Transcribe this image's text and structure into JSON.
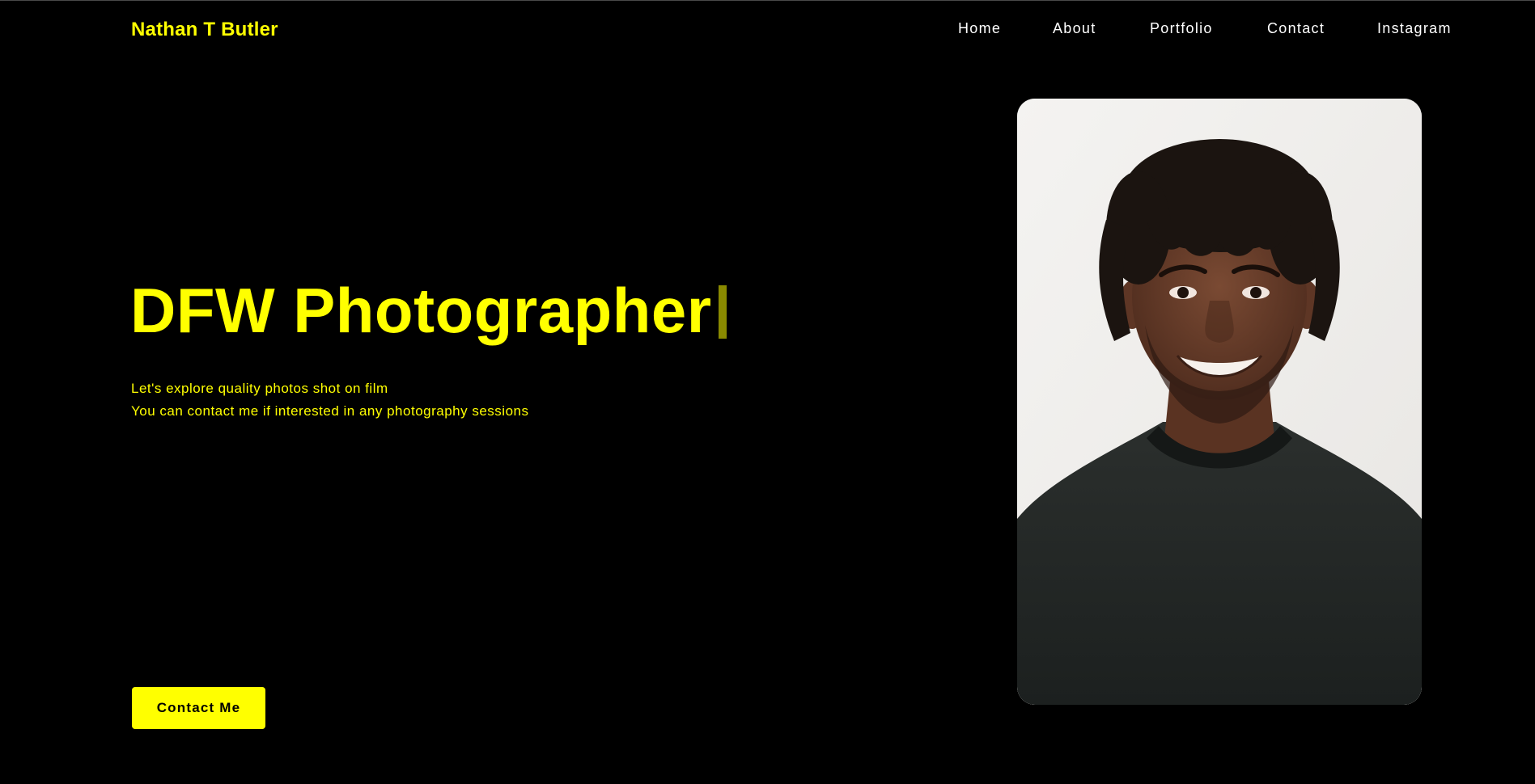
{
  "header": {
    "brand": "Nathan T Butler",
    "nav": [
      "Home",
      "About",
      "Portfolio",
      "Contact",
      "Instagram"
    ]
  },
  "hero": {
    "title": "DFW Photographer",
    "subtitle_lines": [
      "Let's explore quality photos shot on film",
      "You can contact me if interested in any photography sessions"
    ],
    "cta_label": "Contact Me"
  },
  "colors": {
    "background": "#000000",
    "accent": "#ffff00",
    "nav_text": "#ffffff"
  }
}
